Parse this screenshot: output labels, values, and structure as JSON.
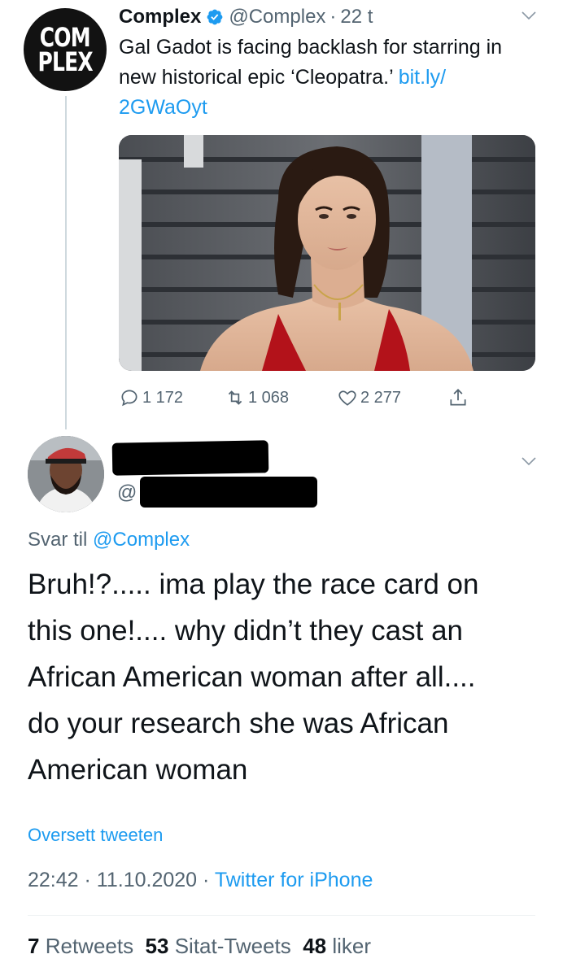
{
  "parent_tweet": {
    "avatar": {
      "line1": "COM",
      "line2": "PLEX"
    },
    "display_name": "Complex",
    "handle": "@Complex",
    "separator": "·",
    "age": "22 t",
    "text": "Gal Gadot is facing backlash for starring in new historical epic ‘Cleopatra.’",
    "link_part1": "bit.ly/",
    "link_part2": "2GWaOyt",
    "actions": {
      "replies": "1 172",
      "retweets": "1 068",
      "likes": "2 277"
    }
  },
  "reply_tweet": {
    "handle_prefix": "@",
    "reply_to_label": "Svar til",
    "reply_to_handle": "@Complex",
    "lines": [
      "Bruh!?..... ima play the race card on",
      "this one!.... why didn’t they cast an",
      "African American woman after all....",
      "do your research she was African",
      "American woman"
    ],
    "translate_label": "Oversett tweeten",
    "time": "22:42",
    "date": "11.10.2020",
    "meta_separator": "·",
    "source": "Twitter for iPhone",
    "stats": {
      "retweets_count": "7",
      "retweets_label": "Retweets",
      "quotes_count": "53",
      "quotes_label": "Sitat-Tweets",
      "likes_count": "48",
      "likes_label": "liker"
    }
  },
  "colors": {
    "link": "#1d9bf0",
    "text": "#0f1419",
    "muted": "#536471",
    "dress": "#b3121a"
  },
  "icons": [
    "verified-badge-icon",
    "chevron-down-icon",
    "reply-icon",
    "retweet-icon",
    "like-icon",
    "share-icon"
  ]
}
